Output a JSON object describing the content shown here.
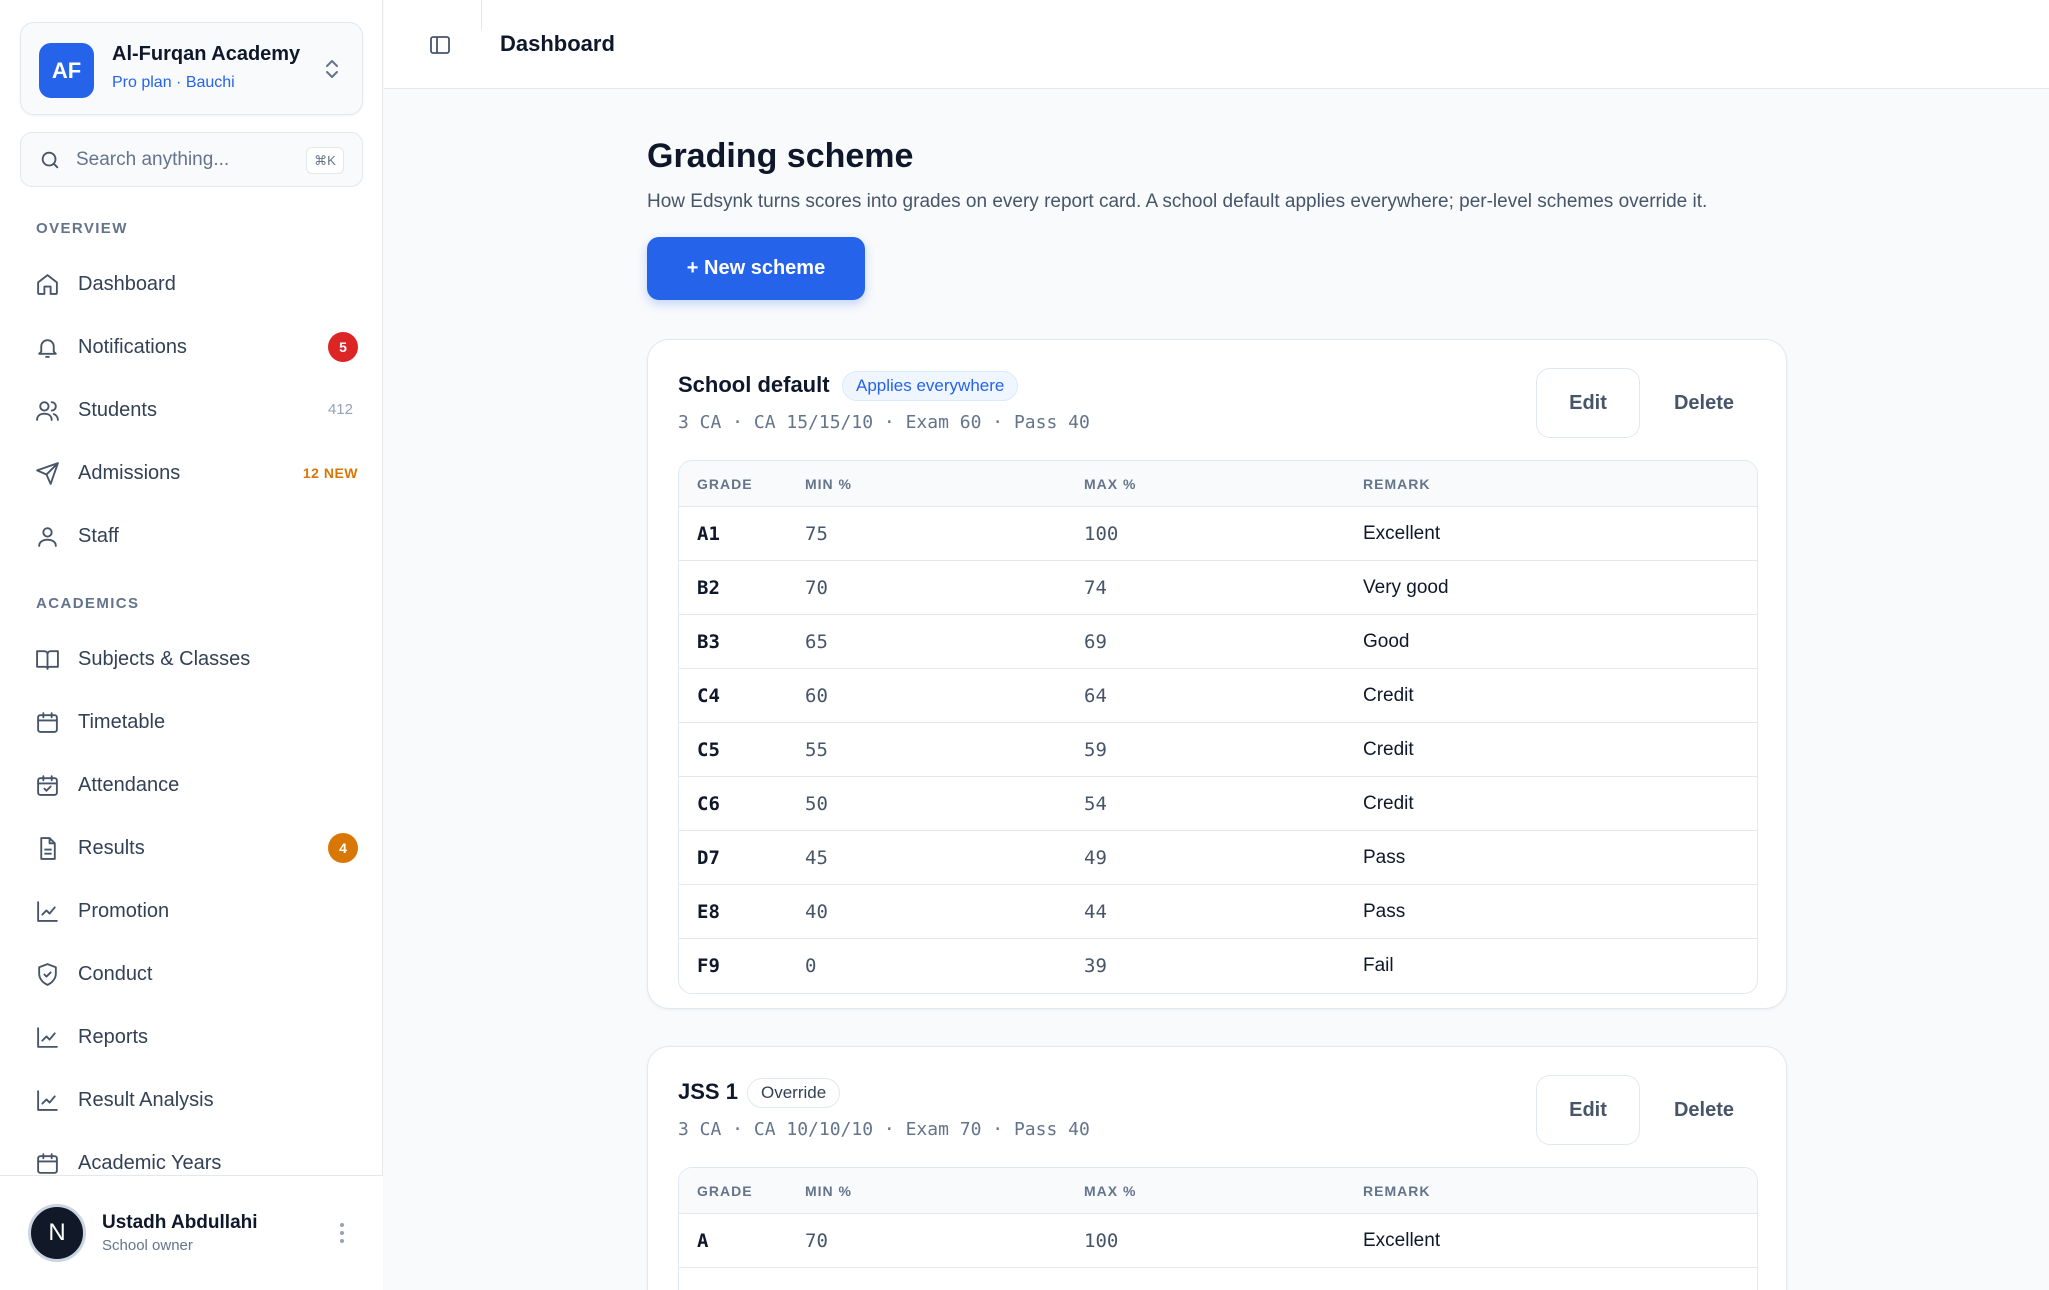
{
  "org": {
    "initials": "AF",
    "name": "Al-Furqan Academy",
    "plan": "Pro plan · Bauchi"
  },
  "search": {
    "placeholder": "Search anything...",
    "shortcut": "⌘K"
  },
  "sidebar": {
    "overview_label": "OVERVIEW",
    "academics_label": "ACADEMICS",
    "overview": [
      {
        "label": "Dashboard",
        "icon": "home-icon"
      },
      {
        "label": "Notifications",
        "icon": "bell-icon",
        "badge": "5"
      },
      {
        "label": "Students",
        "icon": "users-icon",
        "count": "412"
      },
      {
        "label": "Admissions",
        "icon": "send-icon",
        "tag": "12 NEW"
      },
      {
        "label": "Staff",
        "icon": "user-icon"
      }
    ],
    "academics": [
      {
        "label": "Subjects & Classes",
        "icon": "book-icon"
      },
      {
        "label": "Timetable",
        "icon": "calendar-icon"
      },
      {
        "label": "Attendance",
        "icon": "calendar-check-icon"
      },
      {
        "label": "Results",
        "icon": "file-icon",
        "badge": "4"
      },
      {
        "label": "Promotion",
        "icon": "chart-icon"
      },
      {
        "label": "Conduct",
        "icon": "shield-icon"
      },
      {
        "label": "Reports",
        "icon": "chart-icon"
      },
      {
        "label": "Result Analysis",
        "icon": "chart-icon"
      },
      {
        "label": "Academic Years",
        "icon": "calendar-icon"
      }
    ]
  },
  "user": {
    "initial": "N",
    "name": "Ustadh Abdullahi",
    "role": "School owner"
  },
  "topbar": {
    "title": "Dashboard"
  },
  "page": {
    "title": "Grading scheme",
    "description": "How Edsynk turns scores into grades on every report card. A school default applies everywhere; per-level schemes override it.",
    "new_button": "+ New scheme"
  },
  "table_headers": {
    "grade": "GRADE",
    "min": "MIN %",
    "max": "MAX %",
    "remark": "REMARK"
  },
  "schemes": [
    {
      "name": "School default",
      "tag": "Applies everywhere",
      "meta": "3 CA · CA 15/15/10 · Exam 60 · Pass 40",
      "edit": "Edit",
      "delete": "Delete",
      "rows": [
        {
          "grade": "A1",
          "min": "75",
          "max": "100",
          "remark": "Excellent"
        },
        {
          "grade": "B2",
          "min": "70",
          "max": "74",
          "remark": "Very good"
        },
        {
          "grade": "B3",
          "min": "65",
          "max": "69",
          "remark": "Good"
        },
        {
          "grade": "C4",
          "min": "60",
          "max": "64",
          "remark": "Credit"
        },
        {
          "grade": "C5",
          "min": "55",
          "max": "59",
          "remark": "Credit"
        },
        {
          "grade": "C6",
          "min": "50",
          "max": "54",
          "remark": "Credit"
        },
        {
          "grade": "D7",
          "min": "45",
          "max": "49",
          "remark": "Pass"
        },
        {
          "grade": "E8",
          "min": "40",
          "max": "44",
          "remark": "Pass"
        },
        {
          "grade": "F9",
          "min": "0",
          "max": "39",
          "remark": "Fail"
        }
      ]
    },
    {
      "name": "JSS 1",
      "tag": "Override",
      "meta": "3 CA · CA 10/10/10 · Exam 70 · Pass 40",
      "edit": "Edit",
      "delete": "Delete",
      "rows": [
        {
          "grade": "A",
          "min": "70",
          "max": "100",
          "remark": "Excellent"
        }
      ]
    }
  ]
}
